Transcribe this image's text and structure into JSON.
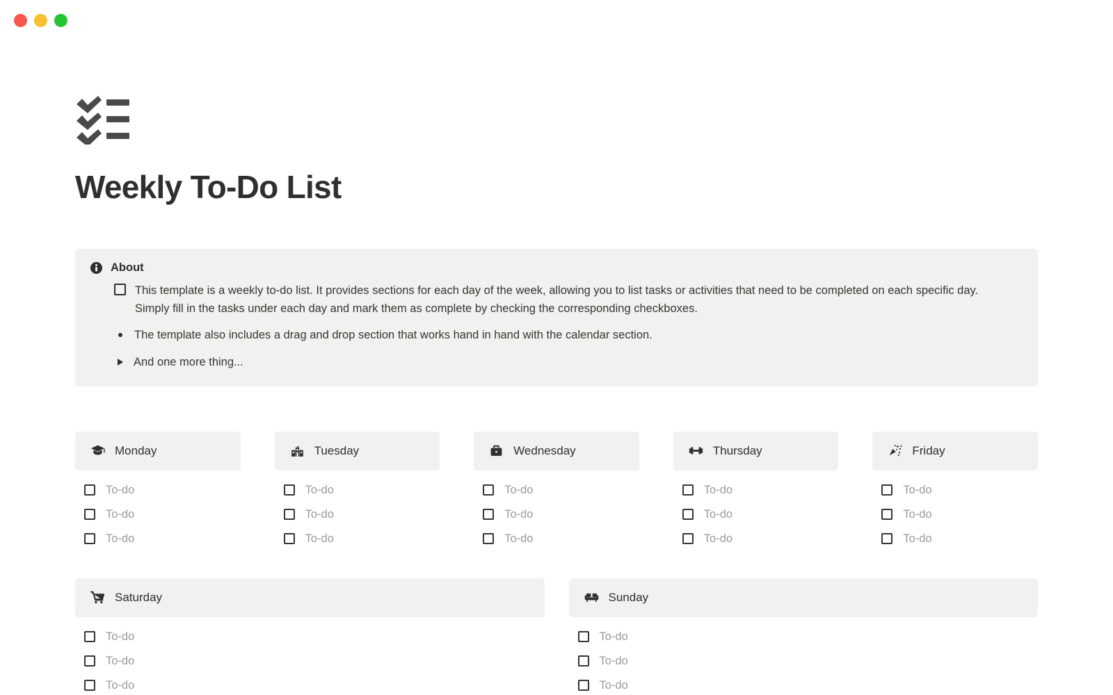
{
  "window": {
    "controls": [
      {
        "name": "close",
        "color": "#f9564f"
      },
      {
        "name": "minimize",
        "color": "#f7c02e"
      },
      {
        "name": "maximize",
        "color": "#23c531"
      }
    ]
  },
  "header": {
    "icon": "checklist-icon",
    "title": "Weekly To-Do List"
  },
  "callout": {
    "icon": "info-icon",
    "title": "About",
    "checkbox_item": "This template is a weekly to-do list. It provides sections for each day of the week, allowing you to list tasks or activities that need to be completed on each specific day. Simply fill in the tasks under each day and mark them as complete by checking the corresponding checkboxes.",
    "bullet_item": "The template also includes a drag and drop section that works hand in hand with the calendar section.",
    "toggle_item": "And one more thing...",
    "background": "#f1f1ef"
  },
  "todo_placeholder": "To-do",
  "weekdays": [
    {
      "label": "Monday",
      "icon": "graduation-cap-icon",
      "todos": [
        "To-do",
        "To-do",
        "To-do"
      ]
    },
    {
      "label": "Tuesday",
      "icon": "school-building-icon",
      "todos": [
        "To-do",
        "To-do",
        "To-do"
      ]
    },
    {
      "label": "Wednesday",
      "icon": "briefcase-icon",
      "todos": [
        "To-do",
        "To-do",
        "To-do"
      ]
    },
    {
      "label": "Thursday",
      "icon": "dumbbell-icon",
      "todos": [
        "To-do",
        "To-do",
        "To-do"
      ]
    },
    {
      "label": "Friday",
      "icon": "confetti-icon",
      "todos": [
        "To-do",
        "To-do",
        "To-do"
      ]
    }
  ],
  "weekend": [
    {
      "label": "Saturday",
      "icon": "shopping-cart-icon",
      "todos": [
        "To-do",
        "To-do",
        "To-do"
      ]
    },
    {
      "label": "Sunday",
      "icon": "couch-icon",
      "todos": [
        "To-do",
        "To-do",
        "To-do"
      ]
    }
  ]
}
